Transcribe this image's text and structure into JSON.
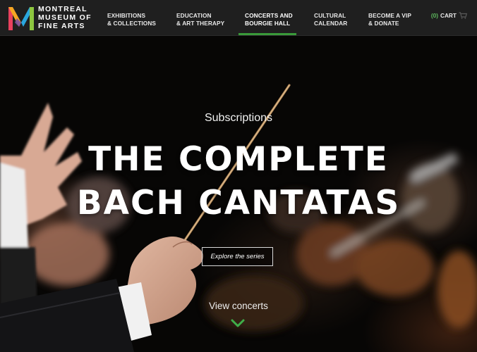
{
  "logo": {
    "lines": [
      "MONTREAL",
      "MUSEUM OF",
      "FINE ARTS"
    ],
    "mark_colors": [
      "#e9415e",
      "#f6a623",
      "#2aa7de",
      "#8dc63f",
      "#7b4fa0"
    ]
  },
  "nav": {
    "items": [
      {
        "line1": "EXHIBITIONS",
        "line2": "& COLLECTIONS"
      },
      {
        "line1": "EDUCATION",
        "line2": "& ART THERAPY"
      },
      {
        "line1": "CONCERTS AND",
        "line2": "BOURGIE HALL"
      },
      {
        "line1": "CULTURAL",
        "line2": "CALENDAR"
      },
      {
        "line1": "BECOME A VIP",
        "line2": "& DONATE"
      }
    ],
    "active_index": 2,
    "cart": {
      "count": "(0)",
      "label": "CART",
      "icon": "shopping-cart-icon"
    },
    "accent_color": "#3a9a3a"
  },
  "hero": {
    "kicker": "Subscriptions",
    "title_lines": [
      "THE COMPLETE",
      "BACH CANTATAS"
    ],
    "cta_label": "Explore the series",
    "view_concerts_label": "View concerts",
    "scroll_icon": "chevron-down-icon"
  }
}
